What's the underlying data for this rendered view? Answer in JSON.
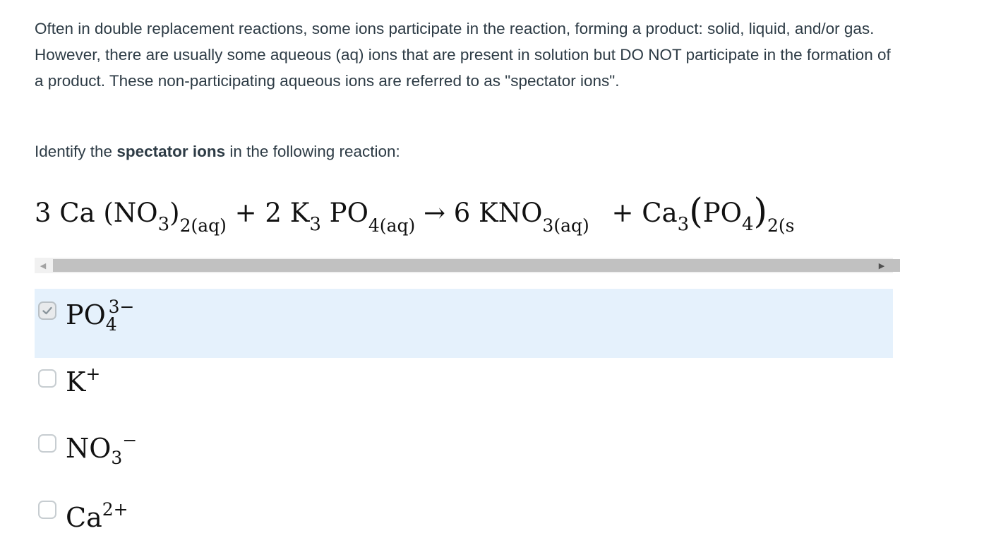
{
  "intro": "Often in double replacement reactions, some ions participate in the reaction, forming a product: solid, liquid, and/or gas. However, there are usually some aqueous (aq) ions that are present in solution but DO NOT participate in the formation of a product. These non-participating aqueous ions are referred to as \"spectator ions\".",
  "prompt": {
    "before": "Identify the ",
    "bold": "spectator ions",
    "after": " in the following reaction:"
  },
  "equation": {
    "t1": "3 Ca (NO",
    "s1": "3",
    "t2": ")",
    "s2": "2(aq)",
    "t3": " + 2 K",
    "s3": "3",
    "t4": " PO",
    "s4": "4(aq)",
    "t5": " → 6 KNO",
    "s5": "3(aq)",
    "t6": " + Ca",
    "s6": "3",
    "t7": "(",
    "t8": "PO",
    "s8": "4",
    "t9": ")",
    "s9": "2(s"
  },
  "options": [
    {
      "base": "PO",
      "sub": "4",
      "sup": "3−",
      "checked": true
    },
    {
      "base": "K",
      "sub": "",
      "sup": "+",
      "checked": false
    },
    {
      "base": "NO",
      "sub": "3",
      "sup": "−",
      "checked": false
    },
    {
      "base": "Ca",
      "sub": "",
      "sup": "2+",
      "checked": false
    }
  ],
  "icons": {
    "check": "check-icon",
    "scroll_left": "triangle-left-icon",
    "scroll_right": "triangle-right-icon"
  },
  "colors": {
    "selected_bg": "#e5f1fc",
    "text": "#2d3b45"
  }
}
